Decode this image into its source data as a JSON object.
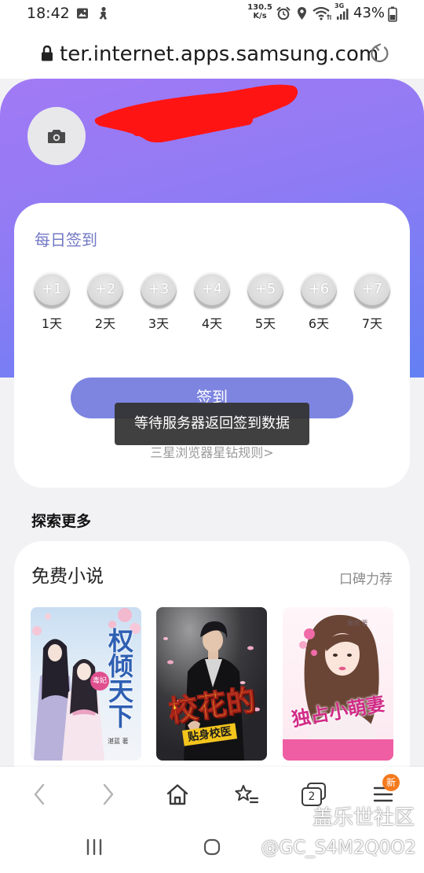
{
  "status_bar": {
    "time": "18:42",
    "net_speed_value": "130.5",
    "net_speed_unit": "K/s",
    "network": "3G",
    "battery": "43%"
  },
  "url_bar": {
    "url": "ter.internet.apps.samsung.com"
  },
  "daily_checkin": {
    "title": "每日签到",
    "days": [
      {
        "reward": "+1",
        "label": "1天"
      },
      {
        "reward": "+2",
        "label": "2天"
      },
      {
        "reward": "+3",
        "label": "3天"
      },
      {
        "reward": "+4",
        "label": "4天"
      },
      {
        "reward": "+5",
        "label": "5天"
      },
      {
        "reward": "+6",
        "label": "6天"
      },
      {
        "reward": "+7",
        "label": "7天"
      }
    ],
    "button_label": "签到",
    "rules_link": "三星浏览器星钻规则>"
  },
  "toast": {
    "message": "等待服务器返回签到数据"
  },
  "explore": {
    "heading": "探索更多"
  },
  "novels": {
    "title": "免费小说",
    "tag": "口碑力荐",
    "books": [
      {
        "title": "权倾天下",
        "badge": "毒妃",
        "author": "湛蓝 著"
      },
      {
        "title": "校花的",
        "subtitle": "贴身校医"
      },
      {
        "title": "独占小萌妻",
        "author": "果肉 著"
      }
    ]
  },
  "bottom_nav": {
    "tabs_count": "2",
    "menu_badge": "新"
  },
  "watermark": {
    "brand": "盖乐世社区",
    "user": "@GC_S4M2Q0O2"
  },
  "icons": {
    "url_bar": [
      "lock-icon",
      "reload-icon"
    ],
    "avatar": "camera-icon",
    "bottom_nav": [
      "back-icon",
      "forward-icon",
      "home-icon",
      "bookmarks-icon",
      "tabs-icon",
      "menu-icon"
    ],
    "system_nav": [
      "recent-apps-icon",
      "home-button-icon"
    ]
  },
  "colors": {
    "header_gradient_start": "#a27af5",
    "header_gradient_end": "#6380f3",
    "checkin_title": "#7379c6",
    "checkin_button": "#7d85e1",
    "menu_badge": "#f47a1f",
    "redaction": "#ff1414"
  }
}
